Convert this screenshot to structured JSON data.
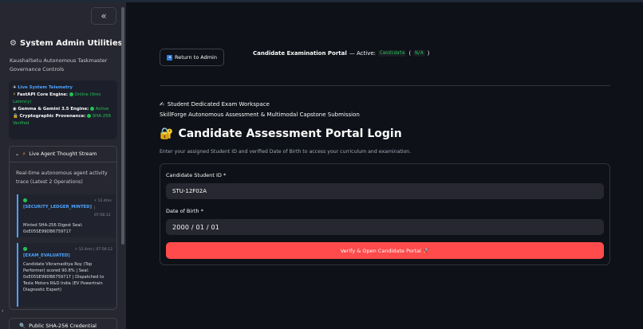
{
  "sidebar": {
    "collapse_label": "«",
    "title": "System Admin Utilities",
    "subtitle": "KaushalSetu Autonomous Taskmaster Governance Controls",
    "telemetry": {
      "heading": "Live System Telemetry",
      "fastapi_label": "FastAPI Core Engine:",
      "fastapi_status": "Online (0ms Latency)",
      "gemma_label": "Gemma & Gemini 3.5 Engine:",
      "gemma_status": "Active",
      "crypto_label": "Cryptographic Provenance:",
      "crypto_status": "SHA-256 Verified"
    },
    "thought_stream": {
      "title": "Live Agent Thought Stream",
      "description": "Real-time autonomous agent activity trace (Latest 2 Operations)",
      "logs": [
        {
          "tag": "[SECURITY_LEDGER_MINTED]",
          "meta1": "⚡ 12.4ms |",
          "meta2": "07:56:12",
          "text": "Minted SHA-256 Digest Seal: 0xE05SE99DB6759717"
        },
        {
          "tag": "[EXAM_EVALUATED]",
          "meta1": "⚡ 12.4ms |",
          "meta2": "07:56:12",
          "text": "Candidate Vikramaditya Roy (Top Performer) scored 90.8% | Seal: 0xE05SE99DB6759717 | Dispatched to Tesla Motors R&D India (EV Powertrain Diagnostic Expert)"
        }
      ]
    },
    "credential_expander": "Public SHA-256 Credential"
  },
  "main": {
    "back_button": "Return to Admin",
    "portal_title": "Candidate Examination Portal",
    "portal_active": "— Active:",
    "portal_role": "Candidate",
    "portal_open_paren": "(",
    "portal_na": "N/A",
    "portal_close_paren": ")",
    "workspace_title": "Student Dedicated Exam Workspace",
    "workspace_subtitle": "SkillForge Autonomous Assessment & Multimodal Capstone Submission",
    "login_title": "Candidate Assessment Portal Login",
    "login_hint": "Enter your assigned Student ID and verified Date of Birth to access your curriculum and examination.",
    "form": {
      "student_id_label": "Candidate Student ID *",
      "student_id_value": "STU-12F02A",
      "dob_label": "Date of Birth *",
      "dob_value": "2000 / 01 / 01",
      "submit_label": "Verify & Open Candidate Portal"
    }
  },
  "colors": {
    "accent": "#ff4b4b",
    "link": "#4da3ff",
    "success": "#21c354",
    "background": "#0e1117",
    "sidebar": "#262730"
  }
}
